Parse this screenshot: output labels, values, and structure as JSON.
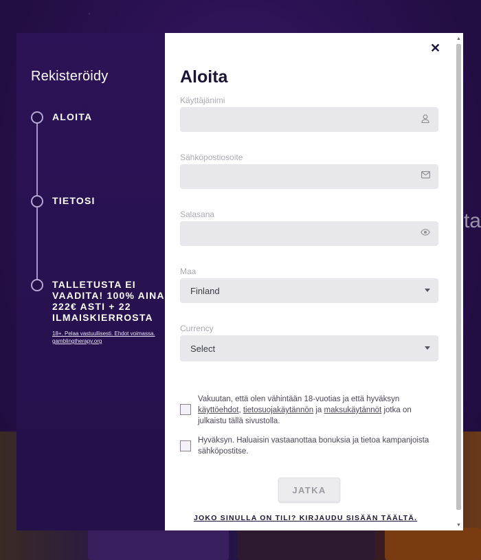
{
  "background": {
    "side_text": "ta"
  },
  "left": {
    "title": "Rekisteröidy",
    "steps": [
      {
        "label": "ALOITA"
      },
      {
        "label": "TIETOSI"
      },
      {
        "label": "TALLETUSTA EI VAADITA! 100% AINA 222€ ASTI + 22 ILMAISKIERROSTA",
        "fine": "18+. Pelaa vastuullisesti. Ehdot voimassa. gamblingtherapy.org"
      }
    ]
  },
  "modal": {
    "close_glyph": "✕",
    "title": "Aloita",
    "fields": {
      "username": {
        "label": "Käyttäjänimi",
        "value": "",
        "icon": "user-icon"
      },
      "email": {
        "label": "Sähköpostiosoite",
        "value": "",
        "icon": "mail-icon"
      },
      "password": {
        "label": "Salasana",
        "value": "",
        "icon": "eye-icon"
      },
      "country": {
        "label": "Maa",
        "value": "Finland"
      },
      "currency": {
        "label": "Currency",
        "value": "Select"
      }
    },
    "consent_terms": {
      "t1": "Vakuutan, että olen vähintään 18-vuotias ja että hyväksyn ",
      "link1": "käyttöehdot",
      "t2": ", ",
      "link2": "tietosuojakäytännön",
      "t3": " ja ",
      "link3": "maksukäytännöt",
      "t4": " jotka on julkaistu tällä sivustolla."
    },
    "consent_marketing": "Hyväksyn. Haluaisin vastaanottaa bonuksia ja tietoa kampanjoista sähköpostitse.",
    "submit_label": "JATKA",
    "login_link": "JOKO SINULLA ON TILI? KIRJAUDU SISÄÄN TÄÄLTÄ."
  },
  "colors": {
    "accent_dark": "#1c1436",
    "panel": "#24104a",
    "input_bg": "#e8e8ec"
  }
}
